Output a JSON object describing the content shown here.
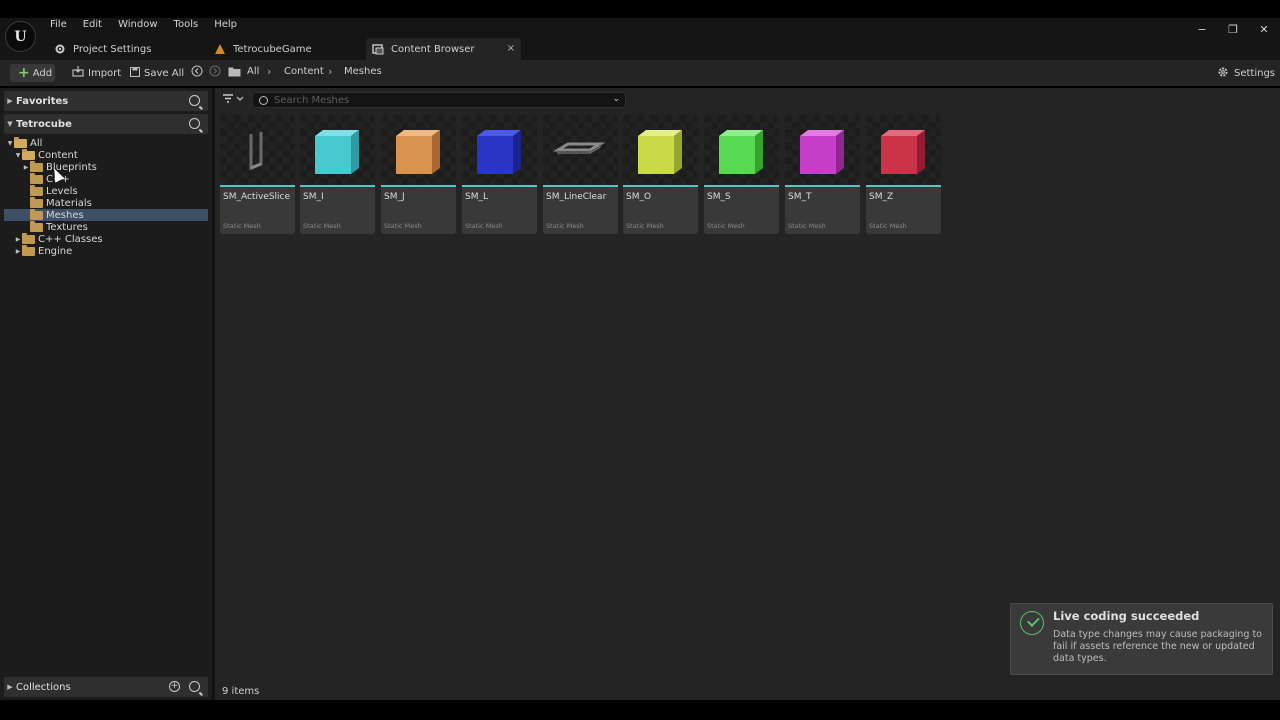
{
  "menu": [
    "File",
    "Edit",
    "Window",
    "Tools",
    "Help"
  ],
  "tabs": [
    {
      "label": "Project Settings",
      "icon": "gear-icon"
    },
    {
      "label": "TetrocubeGame",
      "icon": "unreal-level-icon"
    },
    {
      "label": "Content Browser",
      "icon": "content-browser-icon",
      "close": "×"
    }
  ],
  "window_controls": {
    "minimize": "−",
    "maximize": "❐",
    "close": "✕"
  },
  "toolbar": {
    "add_label": "Add",
    "import_label": "Import",
    "save_all_label": "Save All",
    "breadcrumb": [
      "All",
      "Content",
      "Meshes"
    ],
    "settings_label": "Settings"
  },
  "sidebar": {
    "favorites_label": "Favorites",
    "project_label": "Tetrocube",
    "collections_label": "Collections",
    "tree": [
      {
        "label": "All"
      },
      {
        "label": "Content"
      },
      {
        "label": "Blueprints"
      },
      {
        "label": "C++"
      },
      {
        "label": "Levels"
      },
      {
        "label": "Materials"
      },
      {
        "label": "Meshes"
      },
      {
        "label": "Textures"
      },
      {
        "label": "C++ Classes"
      },
      {
        "label": "Engine"
      }
    ]
  },
  "search": {
    "placeholder": "Search Meshes"
  },
  "assets": [
    {
      "name": "SM_ActiveSlice",
      "type": "Static Mesh",
      "color": "#6a6a6a"
    },
    {
      "name": "SM_I",
      "type": "Static Mesh",
      "color": "#48c8cf"
    },
    {
      "name": "SM_J",
      "type": "Static Mesh",
      "color": "#d8934f"
    },
    {
      "name": "SM_L",
      "type": "Static Mesh",
      "color": "#2a37c6"
    },
    {
      "name": "SM_LineClear",
      "type": "Static Mesh",
      "color": "#8a8a8a"
    },
    {
      "name": "SM_O",
      "type": "Static Mesh",
      "color": "#c9d948"
    },
    {
      "name": "SM_S",
      "type": "Static Mesh",
      "color": "#57d951"
    },
    {
      "name": "SM_T",
      "type": "Static Mesh",
      "color": "#c63fc8"
    },
    {
      "name": "SM_Z",
      "type": "Static Mesh",
      "color": "#c93448"
    }
  ],
  "status": {
    "item_count": "9 items"
  },
  "toast": {
    "title": "Live coding succeeded",
    "message": "Data type changes may cause packaging to fail if assets reference the new or updated data types."
  }
}
